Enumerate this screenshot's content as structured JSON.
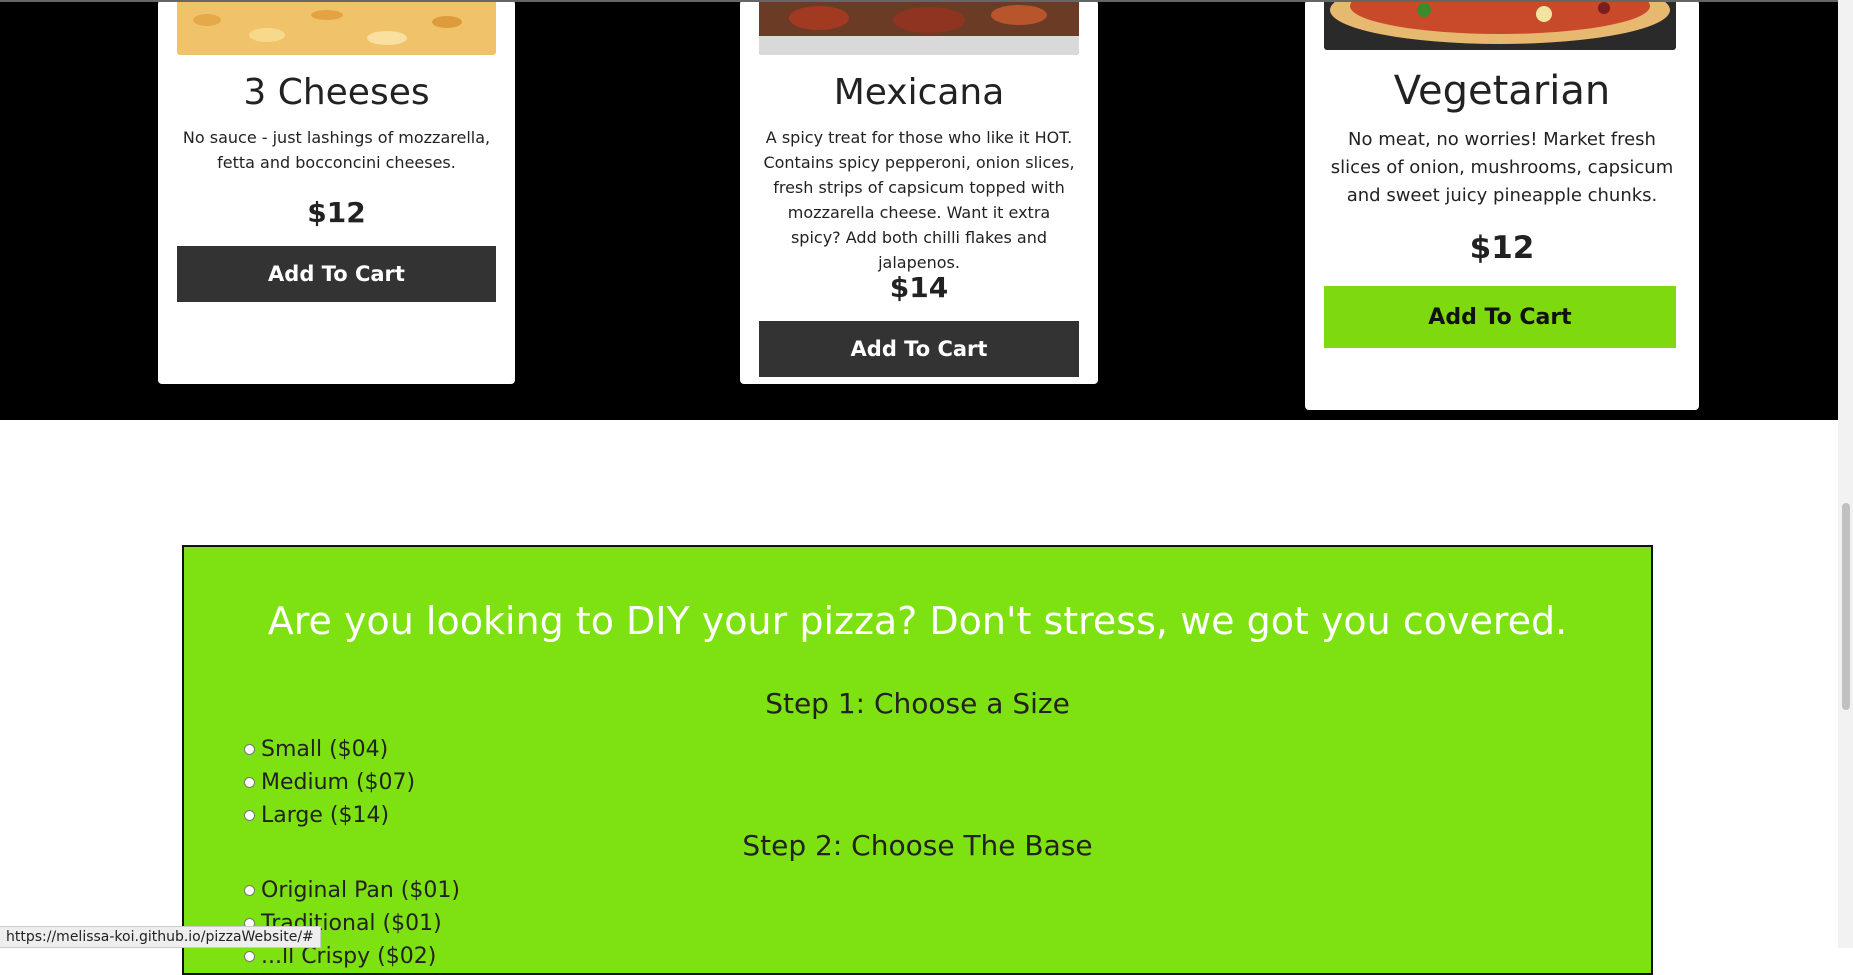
{
  "menu": {
    "cards": [
      {
        "title": "3 Cheeses",
        "desc": "No sauce - just lashings of mozzarella, fetta and bocconcini cheeses.",
        "price": "$12",
        "button": "Add To Cart"
      },
      {
        "title": "Mexicana",
        "desc": "A spicy treat for those who like it HOT. Contains spicy pepperoni, onion slices, fresh strips of capsicum topped with mozzarella cheese. Want it extra spicy? Add both chilli flakes and jalapenos.",
        "price": "$14",
        "button": "Add To Cart"
      },
      {
        "title": "Vegetarian",
        "desc": "No meat, no worries! Market fresh slices of onion, mushrooms, capsicum and sweet juicy pineapple chunks.",
        "price": "$12",
        "button": "Add To Cart"
      }
    ]
  },
  "diy": {
    "title": "Are you looking to DIY your pizza? Don't stress, we got you covered.",
    "step1": "Step 1: Choose a Size",
    "sizes": [
      "Small ($04)",
      "Medium ($07)",
      "Large ($14)"
    ],
    "step2": "Step 2: Choose The Base",
    "bases": [
      "Original Pan ($01)",
      "Traditional ($01)",
      "...ll Crispy ($02)"
    ]
  },
  "status_url": "https://melissa-koi.github.io/pizzaWebsite/#",
  "colors": {
    "accent": "#7ee112",
    "dark_button": "#333333",
    "section_bg": "#000000"
  }
}
